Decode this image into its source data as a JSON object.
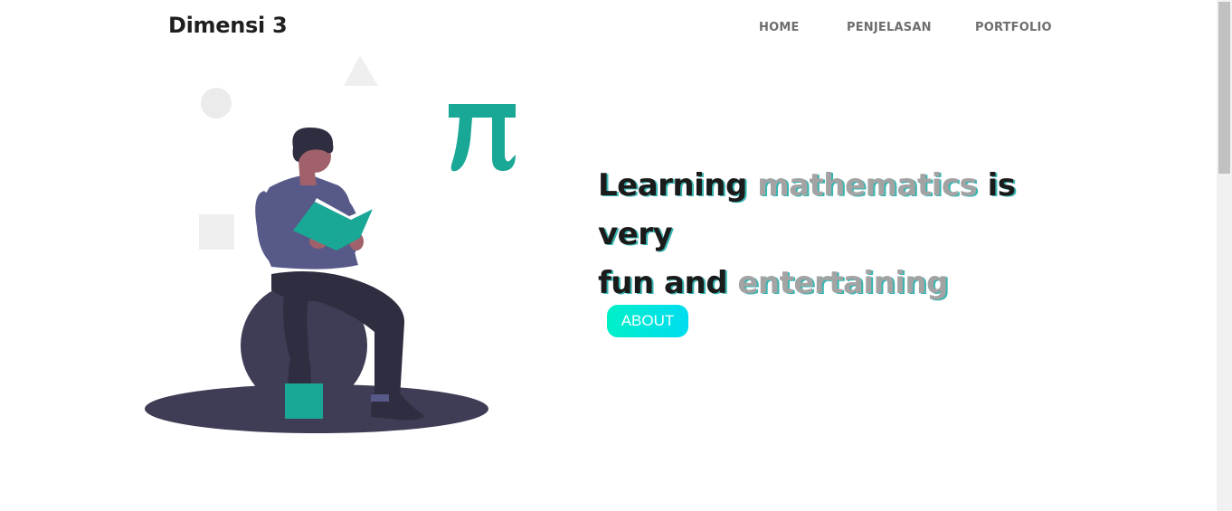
{
  "brand": {
    "name": "Dimensi 3"
  },
  "nav": {
    "items": [
      {
        "label": "HOME"
      },
      {
        "label": "PENJELASAN"
      },
      {
        "label": "PORTFOLIO"
      }
    ]
  },
  "hero": {
    "line1_part1": "Learning ",
    "line1_accent": "mathematics",
    "line1_part2": " is very",
    "line2_part1": "fun and ",
    "line2_accent": "entertaining",
    "button_label": "ABOUT",
    "illustration_symbol": "π"
  },
  "colors": {
    "accent_teal": "#1aa896",
    "button_gradient_start": "#00f0c8",
    "button_gradient_end": "#00dcf0",
    "text_dark": "#1b1b1b",
    "text_muted": "#a3a3a3"
  },
  "icons": {
    "illustration": "person-reading-book-on-ball-illustration",
    "pi": "pi-symbol"
  }
}
